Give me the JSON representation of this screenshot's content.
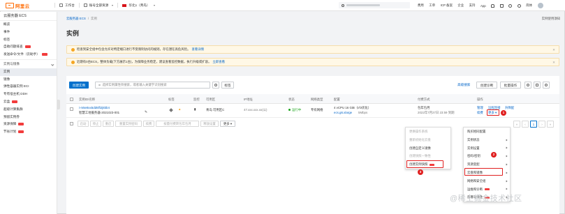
{
  "topbar": {
    "logo_text": "阿里云",
    "workbench": "工作台",
    "account_mgmt": "账号全部资源",
    "region": "华北1（青岛）",
    "links": [
      "费用",
      "工单",
      "ICP 备案",
      "企业",
      "支持",
      "App"
    ],
    "icons": [
      "bell-icon",
      "cart-icon",
      "question-icon",
      "globe-icon"
    ],
    "lang": "简体"
  },
  "sidebar": {
    "title": "云服务器 ECS",
    "items": [
      {
        "label": "概览"
      },
      {
        "label": "事件"
      },
      {
        "label": "标签"
      },
      {
        "label": "自助问题排查"
      },
      {
        "label": "发送命令/文件（云助手）"
      },
      {
        "label": "实例与镜像",
        "group": true
      },
      {
        "label": "实例",
        "active": true
      },
      {
        "label": "镜像"
      },
      {
        "label": "弹性容器实例 ECI"
      },
      {
        "label": "专有宿主机 DDH"
      },
      {
        "label": "云盒"
      },
      {
        "label": "超级计算集群"
      },
      {
        "label": "预留实例券"
      },
      {
        "label": "资源保障"
      },
      {
        "label": "节省计划"
      }
    ]
  },
  "breadcrumb": [
    "云服务器 ECS",
    "实例"
  ],
  "help_link": "实例使用须知",
  "page_title": "实例",
  "notices": [
    {
      "text": "检查到安全组中包含允许对特定端口进行不受限制访问的规则，存在潜在高危风险。",
      "link": "查看详情"
    },
    {
      "text": "近期有0台ECS，整体负载(下方展示1台)，为保障业务稳定，建议查看监控数据，执行升级或扩容。",
      "link": "立即查看"
    }
  ],
  "toolbar": {
    "create_button": "创建实例",
    "search_placeholder": "选择实例属性项搜索，或者输入关键字识别搜索",
    "search_button": "标签",
    "advanced_search": "高级搜索",
    "create_diagnosis": "创建诊断",
    "batch_ops": "批量操作"
  },
  "table": {
    "headers": [
      "实例ID/名称",
      "标签",
      "监控",
      "可用区",
      "IP地址",
      "状态",
      "网络类型",
      "配置",
      "付费方式",
      "操作"
    ],
    "rows": [
      {
        "instance_id": "i-m5e8xx5dd6lfi2j5bb4",
        "instance_name": "智慧工地服务器-2021023-001",
        "zone": "青岛 可用区C",
        "ip": "47.xxx.xxx.xx(公)",
        "status": "运行中",
        "network": "专有网络",
        "config_spec": "4 vCPU 16 GiB（I/O优化）",
        "config_type": "ecs.g6.xlarge",
        "config_bw": "5Mbps",
        "billing": "包年包月",
        "billing_expire": "2022年7月27日 23:59 到期",
        "ops": [
          "管理",
          "远程连接",
          "升降配"
        ],
        "ops_row2": [
          "续费",
          "更多"
        ]
      }
    ]
  },
  "bulk_bar": [
    "启动",
    "停止",
    "重启",
    "重置实例密码",
    "续费",
    "按量付费转包年包月",
    "释放设置",
    "更多"
  ],
  "pagination": {
    "current": "1"
  },
  "more_menu": {
    "items": [
      {
        "label": "购买相同配置"
      },
      {
        "label": "实例状态",
        "sub": true
      },
      {
        "label": "实例设置",
        "sub": true
      },
      {
        "label": "密码/密钥",
        "sub": true
      },
      {
        "label": "资源变配",
        "sub": true
      },
      {
        "label": "云盘和镜像",
        "sub": true,
        "highlight": true
      },
      {
        "label": "网络和安全组",
        "sub": true
      },
      {
        "label": "运维和诊断",
        "sub": true,
        "new": true
      },
      {
        "label": "部署与弹性",
        "sub": true,
        "new": true
      }
    ]
  },
  "image_submenu": {
    "items": [
      {
        "label": "更换操作系统",
        "disabled": true
      },
      {
        "label": "重新初始化云盘",
        "disabled": true
      },
      {
        "label": "创建自定义镜像"
      },
      {
        "label": "创建快照一致性",
        "disabled": true
      },
      {
        "label": "创建实例快照",
        "new": true,
        "highlight": true
      }
    ]
  },
  "callouts": [
    "1",
    "2",
    "3"
  ],
  "watermark": "@稀土掘金技术社区",
  "colors": {
    "brand": "#ff6a00",
    "primary": "#0070cc",
    "link": "#0064c8",
    "callout": "#e02020",
    "running": "#1ca51c"
  }
}
